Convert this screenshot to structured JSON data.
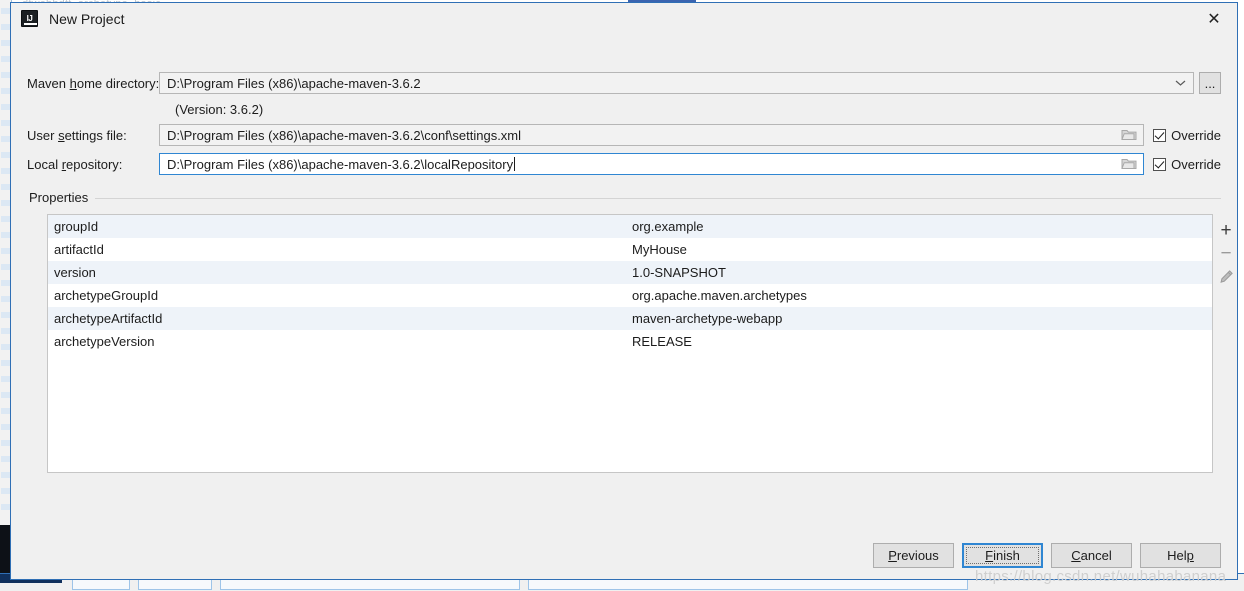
{
  "window": {
    "title": "New Project",
    "app_icon": "intellij-idea-icon",
    "close_label": "✕"
  },
  "fields": {
    "maven_home": {
      "label_before": "Maven ",
      "label_mnemonic": "h",
      "label_after": "ome directory:",
      "value": "D:\\Program Files (x86)\\apache-maven-3.6.2",
      "dropdown_icon": "chevron-down-icon",
      "browse_label": "...",
      "version_note": "(Version: 3.6.2)"
    },
    "user_settings": {
      "label_before": "User ",
      "label_mnemonic": "s",
      "label_after": "ettings file:",
      "value": "D:\\Program Files (x86)\\apache-maven-3.6.2\\conf\\settings.xml",
      "browse_icon": "folder-icon",
      "override_label": "Override",
      "override_checked": true
    },
    "local_repository": {
      "label_before": "Local ",
      "label_mnemonic": "r",
      "label_after": "epository:",
      "value": "D:\\Program Files (x86)\\apache-maven-3.6.2\\localRepository",
      "browse_icon": "folder-icon",
      "override_label": "Override",
      "override_checked": true,
      "focused": true
    }
  },
  "properties": {
    "group_label": "Properties",
    "rows": [
      {
        "key": "groupId",
        "value": "org.example"
      },
      {
        "key": "artifactId",
        "value": "MyHouse"
      },
      {
        "key": "version",
        "value": "1.0-SNAPSHOT"
      },
      {
        "key": "archetypeGroupId",
        "value": "org.apache.maven.archetypes"
      },
      {
        "key": "archetypeArtifactId",
        "value": "maven-archetype-webapp"
      },
      {
        "key": "archetypeVersion",
        "value": "RELEASE"
      }
    ],
    "tools": [
      {
        "name": "add-property-button",
        "glyph": "+",
        "enabled": true
      },
      {
        "name": "remove-property-button",
        "glyph": "−",
        "enabled": false
      },
      {
        "name": "edit-property-button",
        "glyph": "pencil-icon",
        "enabled": false
      }
    ]
  },
  "buttons": {
    "previous": {
      "before": "",
      "mnemonic": "P",
      "after": "revious"
    },
    "finish": {
      "before": "",
      "mnemonic": "F",
      "after": "inish"
    },
    "cancel": {
      "before": "",
      "mnemonic": "C",
      "after": "ancel"
    },
    "help": {
      "before": "Hel",
      "mnemonic": "p",
      "after": ""
    }
  },
  "watermark": "https://blog.csdn.net/wuhahabanana",
  "background": {
    "top_text": "dtwebhdtt_archetype_basic"
  },
  "colors": {
    "accent": "#2f86d2",
    "dialog_bg": "#f0f0f0",
    "row_alt": "#eef3f9",
    "border": "#c6c6c6"
  }
}
